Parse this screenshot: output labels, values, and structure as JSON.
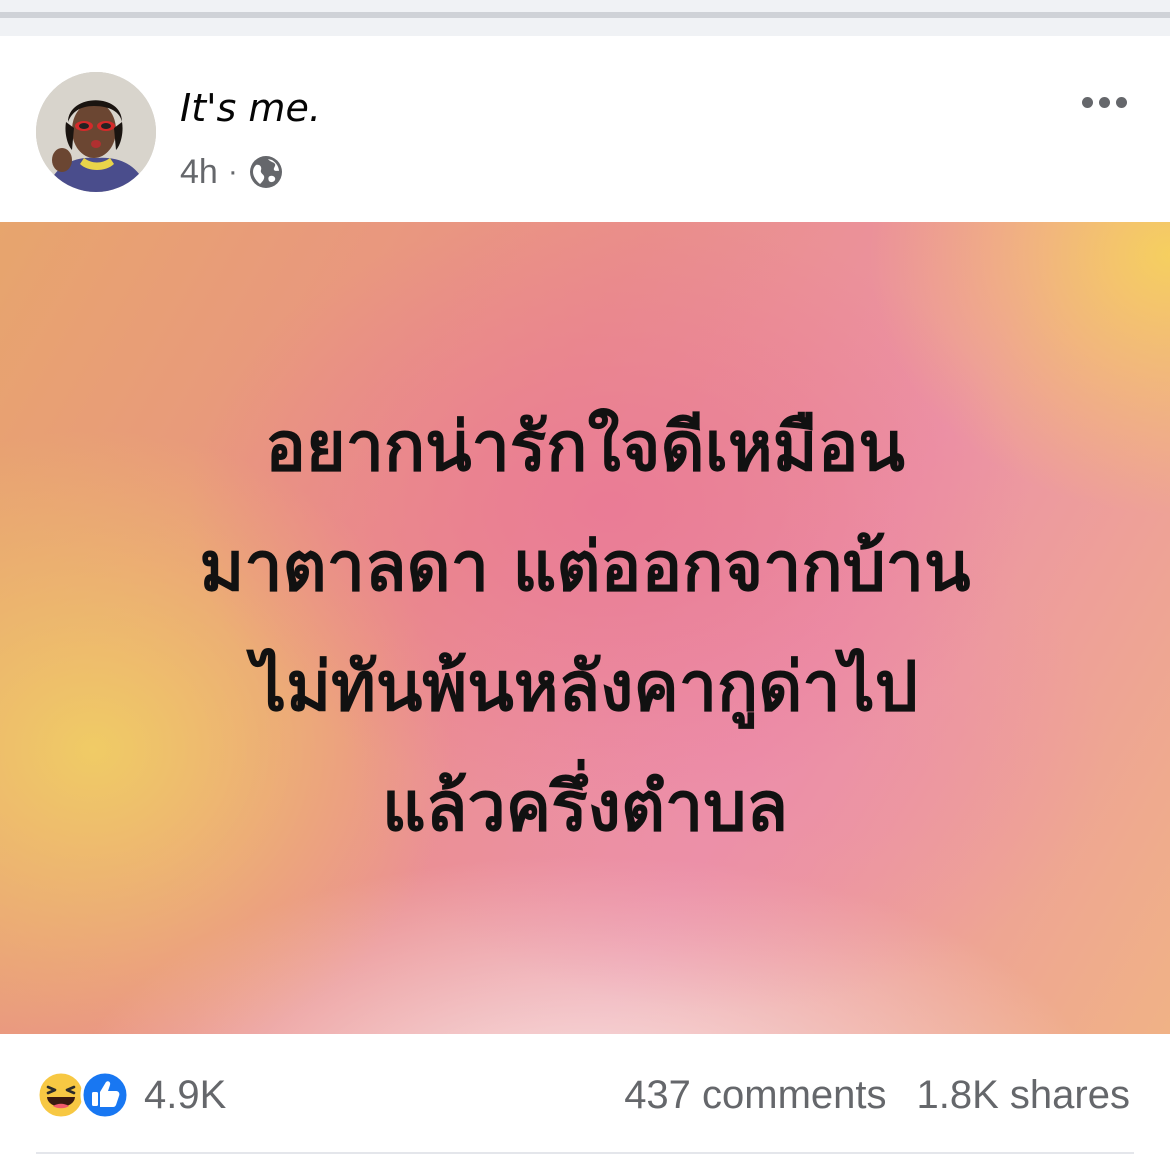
{
  "post": {
    "author": "It's me.",
    "time": "4h",
    "separator": "·",
    "privacy_icon": "globe-icon",
    "more_icon": "more-horizontal-icon",
    "background_text_lines": [
      "อยากน่ารักใจดีเหมือน",
      "มาตาลดา แต่ออกจากบ้าน",
      "ไม่ทันพ้นหลังคากูด่าไป",
      "แล้วครึ่งตำบล"
    ],
    "reaction_icons": [
      "haha-icon",
      "like-icon"
    ],
    "reaction_count": "4.9K",
    "comments": "437 comments",
    "shares": "1.8K shares"
  },
  "colors": {
    "meta_text": "#65676b",
    "like_blue": "#1877f2",
    "haha_yellow": "#f7c843"
  }
}
